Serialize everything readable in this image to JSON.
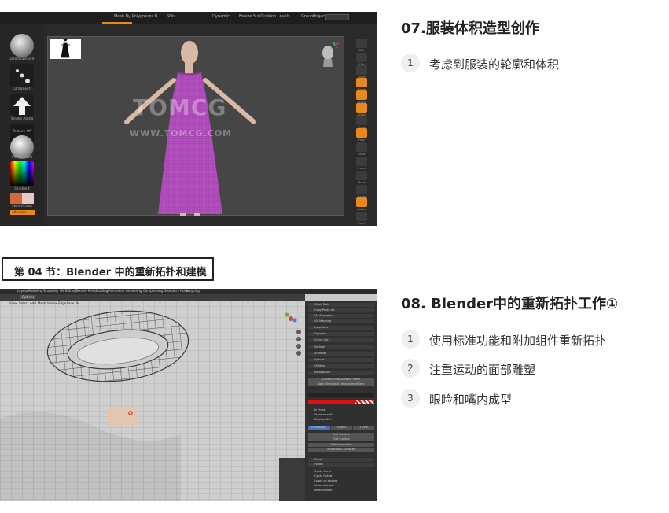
{
  "zbrush": {
    "menu": [
      "Mesh By Polygroups B",
      "SDiv",
      "Dynamic",
      "Freeze SubDivision Levels",
      "Groups",
      "Project"
    ],
    "left_labels": [
      "DamStandard",
      "DragRect",
      "Stroke Alpha",
      "Texture Off",
      "SkinShaded",
      "Gradient",
      "SwitchColor",
      "Alternate"
    ],
    "shelf_labels": [
      "BPR",
      "SPix",
      "Scroll",
      "Zoom",
      "Actual",
      "AAHalf",
      "Persp",
      "Floor",
      "Local",
      "Frame",
      "Move",
      "Scale",
      "Rotate",
      "PolyF",
      "Transp",
      "Ghost",
      "Solo",
      "Xpose"
    ],
    "watermark": "TOMCG",
    "watermark_url": "WWW.TOMCG.COM"
  },
  "section_label": "第 04 节：Blender 中的重新拓扑和建模",
  "blocks": [
    {
      "heading": "07.服装体积造型创作",
      "items": [
        {
          "num": "1",
          "text": "考虑到服装的轮廓和体积"
        }
      ]
    },
    {
      "heading": "08. Blender中的重新拓扑工作①",
      "items": [
        {
          "num": "1",
          "text": "使用标准功能和附加组件重新拓扑"
        },
        {
          "num": "2",
          "text": "注重运动的面部雕塑"
        },
        {
          "num": "3",
          "text": "眼睑和嘴内成型"
        }
      ]
    }
  ],
  "blender": {
    "menu": [
      "Layout",
      "Modeling",
      "Sculpting",
      "UV Editing",
      "Texture Paint",
      "Shading",
      "Animation",
      "Rendering",
      "Compositing",
      "Geometry Nodes",
      "Scripting"
    ],
    "header": [
      "Options",
      "View",
      "Select",
      "Add",
      "Mesh",
      "Vertex",
      "Edge",
      "Face",
      "UV"
    ],
    "panel_rows": [
      "Mesh Tools",
      "Copy/Paste UV",
      "UV Alignment",
      "UV Mapping",
      "LoopTools",
      "Dynamic",
      "Curve Cut",
      "Vertices",
      "Surfaces",
      "Splines",
      "Utilities",
      "RetopoFlow"
    ],
    "panel_buttons": [
      "Conform Edit-Surface mesh",
      "Add Mirror and cleanup modifiers",
      "Add Surface",
      "Edit Surface",
      "Add Annotation",
      "Annotation Surfaces"
    ],
    "panel_checks": [
      "In Front",
      "Show smooth",
      "Display Wire",
      "Cyclic Cross",
      "Cyclic Follow",
      "Loops on strokes",
      "Automatic join",
      "Keep strokes"
    ],
    "panel_tabs": [
      "Annotation",
      "Object",
      "3 Line"
    ],
    "panel_fields": [
      "Cross",
      "Follow"
    ]
  },
  "colors": {
    "accent_orange": "#e88a1a",
    "dress_purple": "#b44fbf",
    "blender_blue": "#4772b3"
  }
}
